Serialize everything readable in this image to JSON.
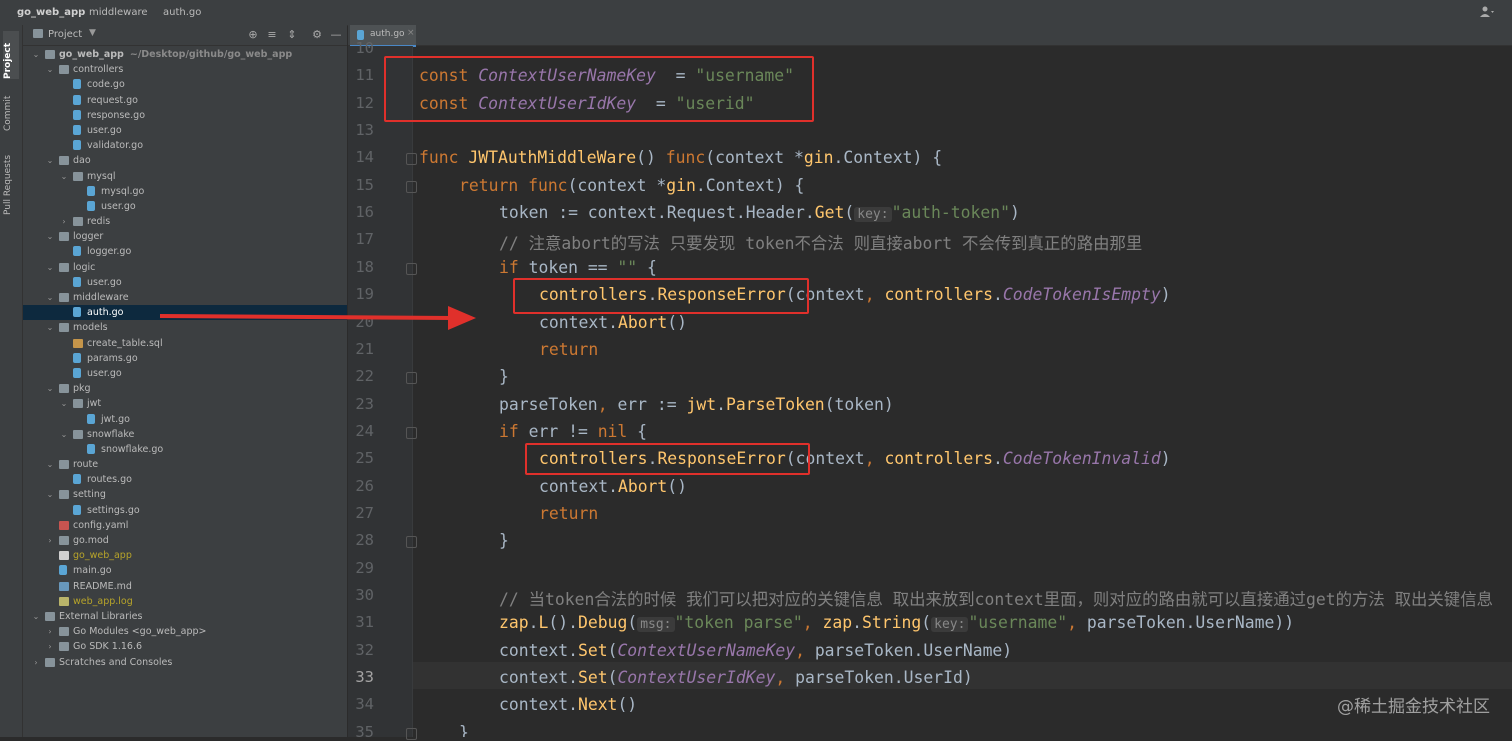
{
  "breadcrumb": {
    "project": "go_web_app",
    "folder": "middleware",
    "file": "auth.go"
  },
  "sidebar_tabs": [
    "Project",
    "Commit",
    "Pull Requests"
  ],
  "project_panel": {
    "title": "Project"
  },
  "tree": [
    {
      "label": "go_web_app",
      "path": "~/Desktop/github/go_web_app",
      "depth": 0,
      "type": "folder",
      "expanded": true,
      "bold": true
    },
    {
      "label": "controllers",
      "depth": 1,
      "type": "folder",
      "expanded": true
    },
    {
      "label": "code.go",
      "depth": 2,
      "type": "go"
    },
    {
      "label": "request.go",
      "depth": 2,
      "type": "go"
    },
    {
      "label": "response.go",
      "depth": 2,
      "type": "go"
    },
    {
      "label": "user.go",
      "depth": 2,
      "type": "go"
    },
    {
      "label": "validator.go",
      "depth": 2,
      "type": "go"
    },
    {
      "label": "dao",
      "depth": 1,
      "type": "folder",
      "expanded": true
    },
    {
      "label": "mysql",
      "depth": 2,
      "type": "folder",
      "expanded": true
    },
    {
      "label": "mysql.go",
      "depth": 3,
      "type": "go"
    },
    {
      "label": "user.go",
      "depth": 3,
      "type": "go"
    },
    {
      "label": "redis",
      "depth": 2,
      "type": "folder",
      "expanded": false
    },
    {
      "label": "logger",
      "depth": 1,
      "type": "folder",
      "expanded": true
    },
    {
      "label": "logger.go",
      "depth": 2,
      "type": "go"
    },
    {
      "label": "logic",
      "depth": 1,
      "type": "folder",
      "expanded": true
    },
    {
      "label": "user.go",
      "depth": 2,
      "type": "go"
    },
    {
      "label": "middleware",
      "depth": 1,
      "type": "folder",
      "expanded": true
    },
    {
      "label": "auth.go",
      "depth": 2,
      "type": "go",
      "selected": true
    },
    {
      "label": "models",
      "depth": 1,
      "type": "folder",
      "expanded": true
    },
    {
      "label": "create_table.sql",
      "depth": 2,
      "type": "sql"
    },
    {
      "label": "params.go",
      "depth": 2,
      "type": "go"
    },
    {
      "label": "user.go",
      "depth": 2,
      "type": "go"
    },
    {
      "label": "pkg",
      "depth": 1,
      "type": "folder",
      "expanded": true
    },
    {
      "label": "jwt",
      "depth": 2,
      "type": "folder",
      "expanded": true
    },
    {
      "label": "jwt.go",
      "depth": 3,
      "type": "go"
    },
    {
      "label": "snowflake",
      "depth": 2,
      "type": "folder",
      "expanded": true
    },
    {
      "label": "snowflake.go",
      "depth": 3,
      "type": "go"
    },
    {
      "label": "route",
      "depth": 1,
      "type": "folder",
      "expanded": true
    },
    {
      "label": "routes.go",
      "depth": 2,
      "type": "go"
    },
    {
      "label": "setting",
      "depth": 1,
      "type": "folder",
      "expanded": true
    },
    {
      "label": "settings.go",
      "depth": 2,
      "type": "go"
    },
    {
      "label": "config.yaml",
      "depth": 1,
      "type": "yaml"
    },
    {
      "label": "go.mod",
      "depth": 1,
      "type": "folder",
      "expanded": false
    },
    {
      "label": "go_web_app",
      "depth": 1,
      "type": "file",
      "yellow": true
    },
    {
      "label": "main.go",
      "depth": 1,
      "type": "go"
    },
    {
      "label": "README.md",
      "depth": 1,
      "type": "md"
    },
    {
      "label": "web_app.log",
      "depth": 1,
      "type": "log",
      "yellow": true
    },
    {
      "label": "External Libraries",
      "depth": 0,
      "type": "lib",
      "expanded": true
    },
    {
      "label": "Go Modules <go_web_app>",
      "depth": 1,
      "type": "lib",
      "expanded": false
    },
    {
      "label": "Go SDK 1.16.6",
      "depth": 1,
      "type": "lib",
      "expanded": false
    },
    {
      "label": "Scratches and Consoles",
      "depth": 0,
      "type": "lib",
      "expanded": false
    }
  ],
  "editor": {
    "tab": "auth.go",
    "current_line": "33",
    "line_numbers": [
      "10",
      "11",
      "12",
      "13",
      "14",
      "15",
      "16",
      "17",
      "18",
      "19",
      "20",
      "21",
      "22",
      "23",
      "24",
      "25",
      "26",
      "27",
      "28",
      "29",
      "30",
      "31",
      "32",
      "33",
      "34",
      "35"
    ],
    "lines": [
      {
        "indent": 0,
        "tokens": []
      },
      {
        "indent": 0,
        "tokens": [
          [
            "kw",
            "const "
          ],
          [
            "cn",
            "ContextUserNameKey"
          ],
          [
            "",
            "  = "
          ],
          [
            "str",
            "\"username\""
          ]
        ]
      },
      {
        "indent": 0,
        "tokens": [
          [
            "kw",
            "const "
          ],
          [
            "cn",
            "ContextUserIdKey"
          ],
          [
            "",
            "  = "
          ],
          [
            "str",
            "\"userid\""
          ]
        ]
      },
      {
        "indent": 0,
        "tokens": []
      },
      {
        "indent": 0,
        "tokens": [
          [
            "kw",
            "func "
          ],
          [
            "fn",
            "JWTAuthMiddleWare"
          ],
          [
            "",
            "() "
          ],
          [
            "kw",
            "func"
          ],
          [
            "",
            "(context *"
          ],
          [
            "pkg",
            "gin"
          ],
          [
            "",
            "."
          ],
          [
            "ty",
            "Context"
          ],
          [
            "",
            ") {"
          ]
        ]
      },
      {
        "indent": 1,
        "tokens": [
          [
            "kw",
            "return "
          ],
          [
            "kw",
            "func"
          ],
          [
            "",
            "(context *"
          ],
          [
            "pkg",
            "gin"
          ],
          [
            "",
            "."
          ],
          [
            "ty",
            "Context"
          ],
          [
            "",
            ") {"
          ]
        ]
      },
      {
        "indent": 2,
        "tokens": [
          [
            "",
            "token := context.Request.Header."
          ],
          [
            "mt",
            "Get"
          ],
          [
            "",
            "("
          ],
          [
            "hint",
            "key:"
          ],
          [
            "str",
            "\"auth-token\""
          ],
          [
            "",
            ")"
          ]
        ]
      },
      {
        "indent": 2,
        "tokens": [
          [
            "cm",
            "// 注意abort的写法 只要发现 token不合法 则直接abort 不会传到真正的路由那里"
          ]
        ]
      },
      {
        "indent": 2,
        "tokens": [
          [
            "kw",
            "if "
          ],
          [
            "",
            "token == "
          ],
          [
            "str",
            "\"\""
          ],
          [
            "",
            " {"
          ]
        ]
      },
      {
        "indent": 3,
        "tokens": [
          [
            "pkg",
            "controllers"
          ],
          [
            "",
            "."
          ],
          [
            "mt",
            "ResponseError"
          ],
          [
            "",
            "(context"
          ],
          [
            "pn",
            ", "
          ],
          [
            "pkg",
            "controllers"
          ],
          [
            "",
            "."
          ],
          [
            "cn",
            "CodeTokenIsEmpty"
          ],
          [
            "",
            ")"
          ]
        ]
      },
      {
        "indent": 3,
        "tokens": [
          [
            "",
            "context."
          ],
          [
            "mt",
            "Abort"
          ],
          [
            "",
            "()"
          ]
        ]
      },
      {
        "indent": 3,
        "tokens": [
          [
            "kw",
            "return"
          ]
        ]
      },
      {
        "indent": 2,
        "tokens": [
          [
            "",
            "}"
          ]
        ]
      },
      {
        "indent": 2,
        "tokens": [
          [
            "",
            "parseToken"
          ],
          [
            "pn",
            ", "
          ],
          [
            "",
            "err := "
          ],
          [
            "pkg",
            "jwt"
          ],
          [
            "",
            "."
          ],
          [
            "mt",
            "ParseToken"
          ],
          [
            "",
            "(token)"
          ]
        ]
      },
      {
        "indent": 2,
        "tokens": [
          [
            "kw",
            "if "
          ],
          [
            "",
            "err != "
          ],
          [
            "kw",
            "nil"
          ],
          [
            "",
            " {"
          ]
        ]
      },
      {
        "indent": 3,
        "tokens": [
          [
            "pkg",
            "controllers"
          ],
          [
            "",
            "."
          ],
          [
            "mt",
            "ResponseError"
          ],
          [
            "",
            "(context"
          ],
          [
            "pn",
            ", "
          ],
          [
            "pkg",
            "controllers"
          ],
          [
            "",
            "."
          ],
          [
            "cn",
            "CodeTokenInvalid"
          ],
          [
            "",
            ")"
          ]
        ]
      },
      {
        "indent": 3,
        "tokens": [
          [
            "",
            "context."
          ],
          [
            "mt",
            "Abort"
          ],
          [
            "",
            "()"
          ]
        ]
      },
      {
        "indent": 3,
        "tokens": [
          [
            "kw",
            "return"
          ]
        ]
      },
      {
        "indent": 2,
        "tokens": [
          [
            "",
            "}"
          ]
        ]
      },
      {
        "indent": 0,
        "tokens": []
      },
      {
        "indent": 2,
        "tokens": [
          [
            "cm",
            "// 当token合法的时候 我们可以把对应的关键信息 取出来放到context里面，则对应的路由就可以直接通过get的方法 取出关键信息"
          ]
        ]
      },
      {
        "indent": 2,
        "tokens": [
          [
            "pkg",
            "zap"
          ],
          [
            "",
            "."
          ],
          [
            "mt",
            "L"
          ],
          [
            "",
            "()."
          ],
          [
            "mt",
            "Debug"
          ],
          [
            "",
            "("
          ],
          [
            "hint",
            "msg:"
          ],
          [
            "str",
            "\"token parse\""
          ],
          [
            "pn",
            ", "
          ],
          [
            "pkg",
            "zap"
          ],
          [
            "",
            "."
          ],
          [
            "mt",
            "String"
          ],
          [
            "",
            "("
          ],
          [
            "hint",
            "key:"
          ],
          [
            "str",
            "\"username\""
          ],
          [
            "pn",
            ", "
          ],
          [
            "",
            "parseToken.UserName))"
          ]
        ]
      },
      {
        "indent": 2,
        "tokens": [
          [
            "",
            "context."
          ],
          [
            "mt",
            "Set"
          ],
          [
            "",
            "("
          ],
          [
            "cn",
            "ContextUserNameKey"
          ],
          [
            "pn",
            ", "
          ],
          [
            "",
            "parseToken.UserName)"
          ]
        ]
      },
      {
        "indent": 2,
        "tokens": [
          [
            "",
            "context."
          ],
          [
            "mt",
            "Set"
          ],
          [
            "",
            "("
          ],
          [
            "cn",
            "ContextUserIdKey"
          ],
          [
            "pn",
            ", "
          ],
          [
            "",
            "parseToken.UserId)"
          ]
        ]
      },
      {
        "indent": 2,
        "tokens": [
          [
            "",
            "context."
          ],
          [
            "mt",
            "Next"
          ],
          [
            "",
            "()"
          ]
        ]
      },
      {
        "indent": 1,
        "tokens": [
          [
            "",
            "}"
          ]
        ]
      }
    ]
  },
  "watermark": "@稀土掘金技术社区",
  "colors": {
    "highlight_box": "#e0302b",
    "arrow": "#e0302b"
  }
}
